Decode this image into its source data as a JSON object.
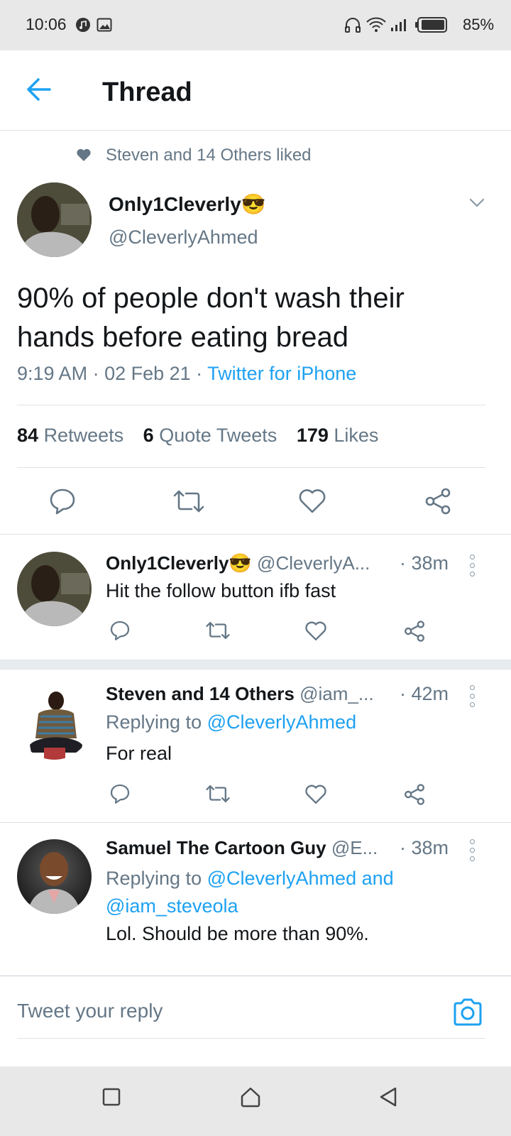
{
  "status_bar": {
    "time": "10:06",
    "battery": "85%"
  },
  "header": {
    "title": "Thread"
  },
  "main_tweet": {
    "social_context": "Steven and 14 Others liked",
    "author_name": "Only1Cleverly😎",
    "author_handle": "@CleverlyAhmed",
    "text": "90% of people don't wash their hands before eating bread",
    "time": "9:19 AM",
    "date": "02 Feb 21",
    "source": "Twitter for iPhone",
    "stats": {
      "retweets_count": "84",
      "retweets_label": "Retweets",
      "quotes_count": "6",
      "quotes_label": "Quote Tweets",
      "likes_count": "179",
      "likes_label": "Likes"
    }
  },
  "replies": [
    {
      "name": "Only1Cleverly😎",
      "handle": "@CleverlyA...",
      "time": "· 38m",
      "text": "Hit the follow button ifb fast"
    },
    {
      "name": "Steven and 14 Others",
      "handle": "@iam_...",
      "time": "· 42m",
      "replying_prefix": "Replying to",
      "replying_to": "@CleverlyAhmed",
      "text": "For real"
    },
    {
      "name": "Samuel The Cartoon Guy",
      "handle": "@E...",
      "time": "· 38m",
      "replying_prefix": "Replying to",
      "replying_to": "@CleverlyAhmed and",
      "replying_to_2": "@iam_steveola",
      "text": "Lol. Should be more than 90%."
    }
  ],
  "compose": {
    "placeholder": "Tweet your reply"
  },
  "colors": {
    "accent": "#1da1f2",
    "muted": "#657786",
    "divider": "#dfe3e6",
    "statusbar": "#e8e8e8"
  }
}
